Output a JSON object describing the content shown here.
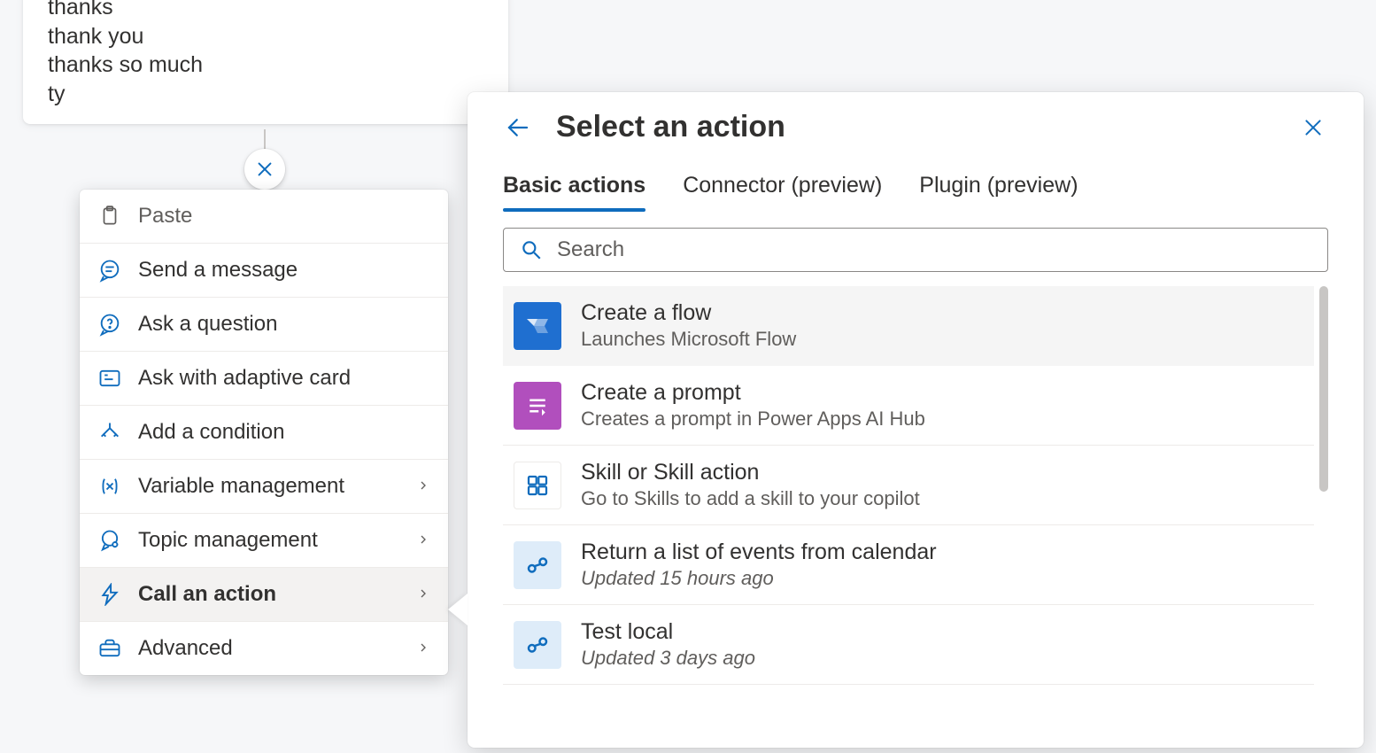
{
  "phrases": [
    "thanks",
    "thank you",
    "thanks so much",
    "ty"
  ],
  "menu": {
    "paste": "Paste",
    "items": [
      {
        "label": "Send a message",
        "chevron": false
      },
      {
        "label": "Ask a question",
        "chevron": false
      },
      {
        "label": "Ask with adaptive card",
        "chevron": false
      },
      {
        "label": "Add a condition",
        "chevron": false
      },
      {
        "label": "Variable management",
        "chevron": true
      },
      {
        "label": "Topic management",
        "chevron": true
      },
      {
        "label": "Call an action",
        "chevron": true,
        "active": true
      },
      {
        "label": "Advanced",
        "chevron": true
      }
    ]
  },
  "panel": {
    "title": "Select an action",
    "tabs": [
      "Basic actions",
      "Connector (preview)",
      "Plugin (preview)"
    ],
    "activeTab": 0,
    "searchPlaceholder": "Search",
    "actions": [
      {
        "title": "Create a flow",
        "subtitle": "Launches Microsoft Flow",
        "iconClass": "ic-flow",
        "hovered": true
      },
      {
        "title": "Create a prompt",
        "subtitle": "Creates a prompt in Power Apps AI Hub",
        "iconClass": "ic-prompt"
      },
      {
        "title": "Skill or Skill action",
        "subtitle": "Go to Skills to add a skill to your copilot",
        "iconClass": "ic-skill"
      },
      {
        "title": "Return a list of events from calendar",
        "subtitle": "Updated 15 hours ago",
        "italic": true,
        "iconClass": "ic-flowlight"
      },
      {
        "title": "Test local",
        "subtitle": "Updated 3 days ago",
        "italic": true,
        "iconClass": "ic-flowlight"
      }
    ]
  }
}
